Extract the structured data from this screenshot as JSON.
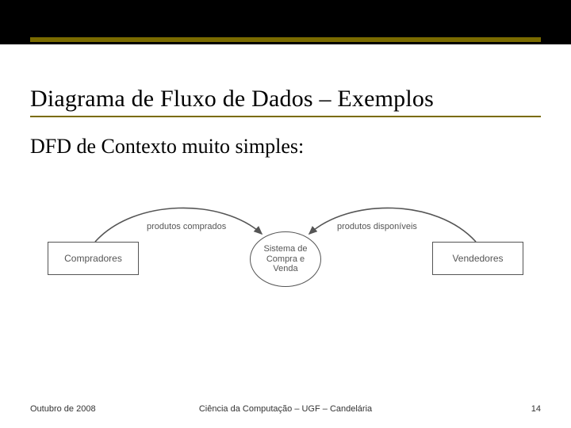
{
  "title": "Diagrama de Fluxo de Dados – Exemplos",
  "subtitle": "DFD de Contexto muito simples:",
  "diagram": {
    "left_entity": "Compradores",
    "right_entity": "Vendedores",
    "process": "Sistema de Compra e Venda",
    "flow_left": "produtos comprados",
    "flow_right": "produtos disponíveis"
  },
  "footer": {
    "left": "Outubro de 2008",
    "center": "Ciência da Computação – UGF – Candelária",
    "right": "14"
  },
  "colors": {
    "accent": "#7a6b00",
    "band": "#000000"
  }
}
